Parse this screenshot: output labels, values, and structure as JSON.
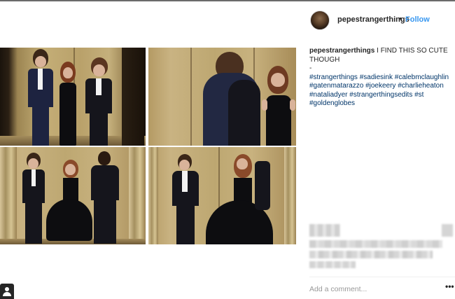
{
  "post": {
    "username": "pepestrangerthings",
    "separator": "•",
    "follow_label": "Follow",
    "caption_text": "I FIND THIS SO CUTE THOUGH",
    "caption_dash": "-",
    "hashtags": [
      "#strangerthings",
      "#sadiesink",
      "#calebmclaughlin",
      "#gatenmatarazzo",
      "#joekeery",
      "#charlieheaton",
      "#nataliadyer",
      "#strangerthingsedits",
      "#st",
      "#goldenglobes"
    ],
    "comment_placeholder": "Add a comment...",
    "more_label": "•••"
  },
  "icons": {
    "avatar": "avatar",
    "more": "more-options-icon",
    "tag": "user-tag-icon"
  },
  "colors": {
    "link": "#003569",
    "follow": "#3897f0",
    "text": "#262626"
  }
}
